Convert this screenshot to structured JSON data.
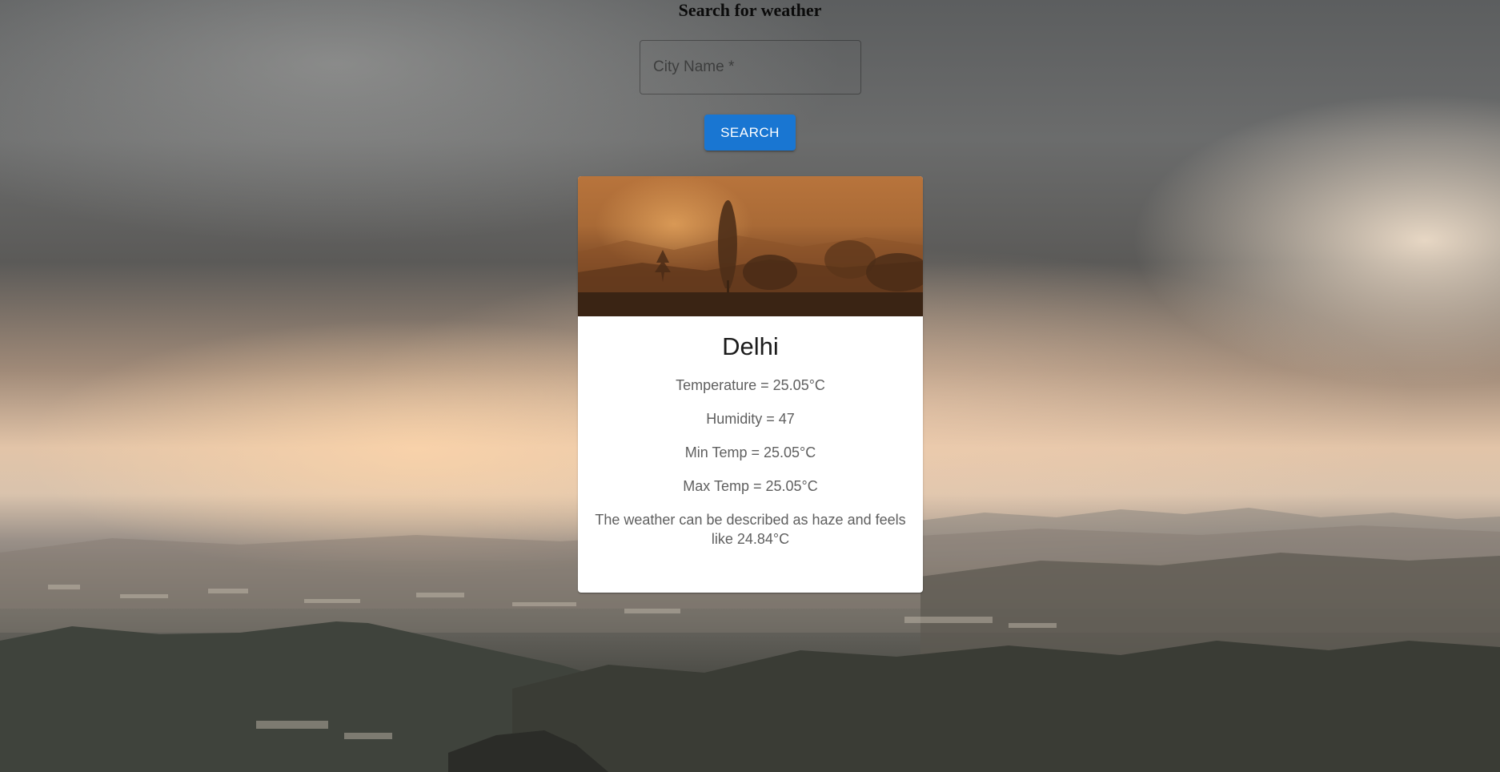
{
  "page": {
    "heading": "Search for weather"
  },
  "search": {
    "label": "City Name *",
    "value": "",
    "button_label": "SEARCH",
    "button_color": "#1976d2"
  },
  "weather_card": {
    "city": "Delhi",
    "temperature": "Temperature = 25.05°C",
    "humidity": "Humidity = 47",
    "min_temp": "Min Temp = 25.05°C",
    "max_temp": "Max Temp = 25.05°C",
    "description": "The weather can be described as haze and feels like 24.84°C"
  }
}
